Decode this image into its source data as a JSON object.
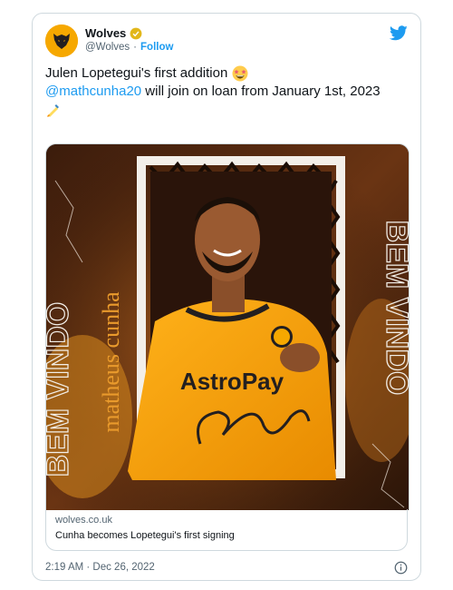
{
  "tweet": {
    "display_name": "Wolves",
    "handle": "@Wolves",
    "dot": "·",
    "follow_label": "Follow",
    "text_line1": "Julen Lopetegui's first addition",
    "mention": "@mathcunha20",
    "text_line2_rest": " will join on loan from January 1st, 2023",
    "timestamp": "2:19 AM · Dec 26, 2022"
  },
  "media": {
    "vertical_name": "matheus cunha",
    "bem_vindo": "BEM VINDO",
    "shirt_sponsor": "AstroPay"
  },
  "link_card": {
    "domain": "wolves.co.uk",
    "title": "Cunha becomes Lopetegui's first signing"
  },
  "colors": {
    "brand_gold": "#f6a800",
    "link_blue": "#1d9bf0",
    "muted": "#536471"
  },
  "icons": [
    "wolves-logo-icon",
    "verified-badge-icon",
    "twitter-bird-icon",
    "star-struck-emoji-icon",
    "writing-hand-emoji-icon",
    "info-icon"
  ]
}
